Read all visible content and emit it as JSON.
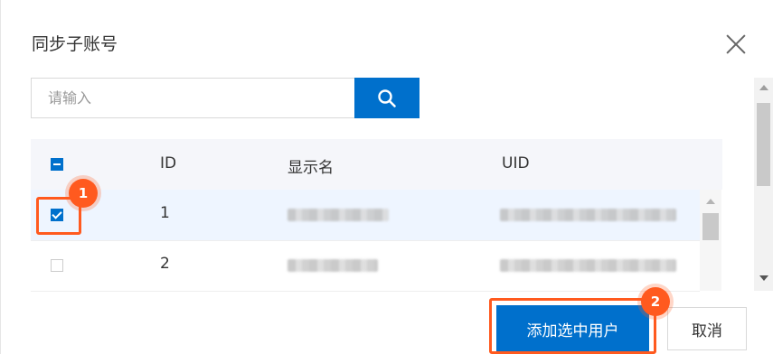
{
  "dialog": {
    "title": "同步子账号",
    "close_icon": "close-icon"
  },
  "search": {
    "placeholder": "请输入",
    "value": "",
    "icon": "search-icon"
  },
  "table": {
    "headers": {
      "select_all": "",
      "id": "ID",
      "display_name": "显示名",
      "uid": "UID"
    },
    "select_all_state": "indeterminate",
    "rows": [
      {
        "id": "1",
        "checked": true,
        "display_name": "[blurred]",
        "uid": "[blurred]"
      },
      {
        "id": "2",
        "checked": false,
        "display_name": "[blurred]",
        "uid": "[blurred]"
      }
    ]
  },
  "footer": {
    "add_selected_label": "添加选中用户",
    "cancel_label": "取消"
  },
  "annotations": [
    {
      "number": "1",
      "target": "row-1-checkbox"
    },
    {
      "number": "2",
      "target": "add-selected-users-button"
    }
  ],
  "colors": {
    "primary": "#0070cc",
    "annotation": "#ff5a1f",
    "header_bg": "#f5f6fa",
    "selected_row_bg": "#eef5ff"
  }
}
